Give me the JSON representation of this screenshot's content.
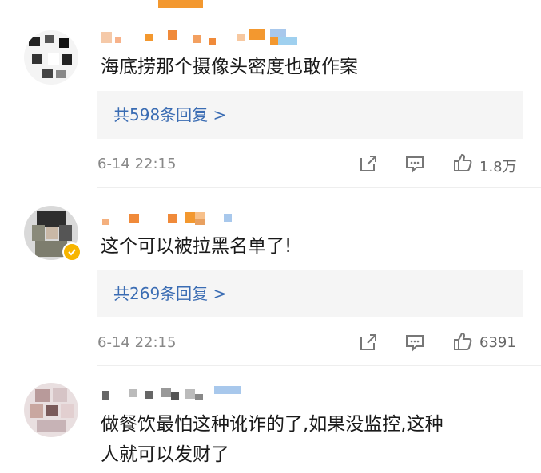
{
  "comments": [
    {
      "text": "海底捞那个摄像头密度也敢作案",
      "reply_label": "共598条回复 >",
      "time": "6-14 22:15",
      "like_count": "1.8万"
    },
    {
      "text": "这个可以被拉黑名单了!",
      "reply_label": "共269条回复 >",
      "time": "6-14 22:15",
      "like_count": "6391"
    },
    {
      "text_line1": "做餐饮最怕这种讹诈的了,如果没监控,这种",
      "text_line2": "人就可以发财了"
    }
  ],
  "icons": [
    "share-icon",
    "comment-icon",
    "like-icon"
  ],
  "colors": {
    "link": "#3a6cb3",
    "accent": "#f3982f",
    "verified": "#f7b500"
  }
}
